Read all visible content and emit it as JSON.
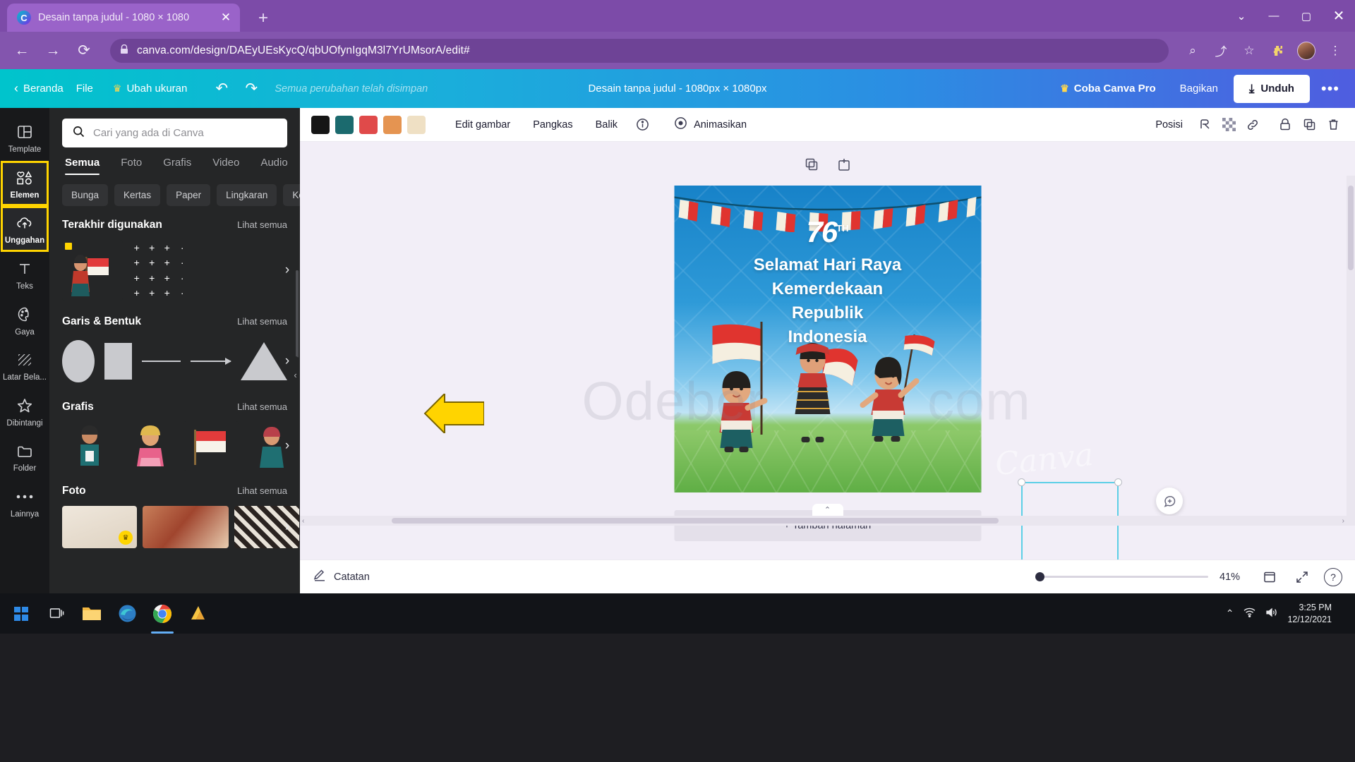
{
  "browser": {
    "tab": {
      "title": "Desain tanpa judul - 1080 × 1080",
      "favicon": "C",
      "close_icon": "✕"
    },
    "new_tab_icon": "+",
    "window_controls": {
      "expand": "⌄",
      "minimize": "—",
      "maximize": "▢",
      "close": "✕"
    },
    "nav": {
      "back_icon": "←",
      "forward_icon": "→",
      "reload_icon": "⟳"
    },
    "url": "canva.com/design/DAEyUEsKycQ/qbUOfynIgqM3l7YrUMsorA/edit#",
    "lock_icon": "🔒",
    "toolbar_icons": {
      "search": "⌕",
      "share": "⤴",
      "bookmark": "☆",
      "extensions": "🧩"
    }
  },
  "canva_header": {
    "back_icon": "‹",
    "home_label": "Beranda",
    "file_label": "File",
    "resize_label": "Ubah ukuran",
    "resize_crown": "♛",
    "undo_icon": "↶",
    "redo_icon": "↷",
    "saved_message": "Semua perubahan telah disimpan",
    "doc_title": "Desain tanpa judul - 1080px × 1080px",
    "pro_label": "Coba Canva Pro",
    "pro_crown": "♛",
    "share_label": "Bagikan",
    "download_label": "Unduh",
    "download_icon": "⤓",
    "more_icon": "•••"
  },
  "rail": {
    "items": [
      {
        "label": "Template",
        "icon": "template-icon",
        "selected": false
      },
      {
        "label": "Elemen",
        "icon": "elements-icon",
        "selected": true
      },
      {
        "label": "Unggahan",
        "icon": "upload-cloud-icon",
        "selected": true
      },
      {
        "label": "Teks",
        "icon": "text-icon",
        "selected": false
      },
      {
        "label": "Gaya",
        "icon": "palette-icon",
        "selected": false
      },
      {
        "label": "Latar Bela...",
        "icon": "background-icon",
        "selected": false
      },
      {
        "label": "Dibintangi",
        "icon": "star-icon",
        "selected": false
      },
      {
        "label": "Folder",
        "icon": "folder-icon",
        "selected": false
      },
      {
        "label": "Lainnya",
        "icon": "more-dots-icon",
        "selected": false
      }
    ]
  },
  "panel": {
    "search_placeholder": "Cari yang ada di Canva",
    "search_value": "",
    "tabs": [
      {
        "label": "Semua",
        "active": true
      },
      {
        "label": "Foto",
        "active": false
      },
      {
        "label": "Grafis",
        "active": false
      },
      {
        "label": "Video",
        "active": false
      },
      {
        "label": "Audio",
        "active": false
      }
    ],
    "chips": [
      "Bunga",
      "Kertas",
      "Paper",
      "Lingkaran",
      "Ke"
    ],
    "chips_more_icon": "›",
    "sections": [
      {
        "title": "Terakhir digunakan",
        "link": "Lihat semua",
        "arrow": "›"
      },
      {
        "title": "Garis & Bentuk",
        "link": "Lihat semua",
        "arrow": "›"
      },
      {
        "title": "Grafis",
        "link": "Lihat semua",
        "arrow": "›"
      },
      {
        "title": "Foto",
        "link": "Lihat semua",
        "arrow": "›"
      }
    ],
    "collapse_icon": "‹"
  },
  "edit_toolbar": {
    "swatches": [
      "#151515",
      "#1b6a6e",
      "#e04a4a",
      "#e59451",
      "#efe0c4"
    ],
    "edit_image_label": "Edit gambar",
    "crop_label": "Pangkas",
    "flip_label": "Balik",
    "info_icon": "ⓘ",
    "animate_label": "Animasikan",
    "animate_icon": "◎",
    "position_label": "Posisi",
    "transparency_icon": "▨",
    "link_icon": "🔗",
    "lock_icon": "🔒",
    "duplicate_icon": "⧉",
    "delete_icon": "🗑",
    "effects_icon": "⌨"
  },
  "canvas": {
    "page_tools": {
      "duplicate_icon": "⧉",
      "add_icon": "⊞"
    },
    "design": {
      "badge_number": "76",
      "badge_suffix": "TH",
      "heading_lines": [
        "Selamat Hari Raya",
        "Kemerdekaan",
        "Republik",
        "Indonesia"
      ]
    },
    "watermarks": {
      "site": "Odeber",
      "site2": "com",
      "brand": "Canva"
    },
    "selection": {
      "rotate_icon": "↻"
    },
    "comment_icon": "♡",
    "add_page_label": "+ Tambah halaman",
    "scroll_left_icon": "‹",
    "scroll_right_icon": "›",
    "collapse_icon": "⌃"
  },
  "bottom_bar": {
    "notes_label": "Catatan",
    "notes_icon": "✎",
    "zoom_value": "41%",
    "pages_icon": "▣",
    "fullscreen_icon": "⤢",
    "help_icon": "?"
  },
  "taskbar": {
    "start_icon": "windows-logo",
    "taskview_icon": "❏",
    "apps": [
      "file-explorer",
      "edge-browser",
      "chrome-browser",
      "canva-app"
    ],
    "tray": {
      "chevron": "⌃",
      "wifi": "📶",
      "volume": "🔊"
    },
    "time": "3:25 PM",
    "date": "12/12/2021"
  },
  "colors": {
    "canva_teal": "#00c4cc",
    "canva_purple": "#7d2ae8",
    "highlight_yellow": "#ffd400",
    "selection_blue": "#5ccfe6"
  }
}
